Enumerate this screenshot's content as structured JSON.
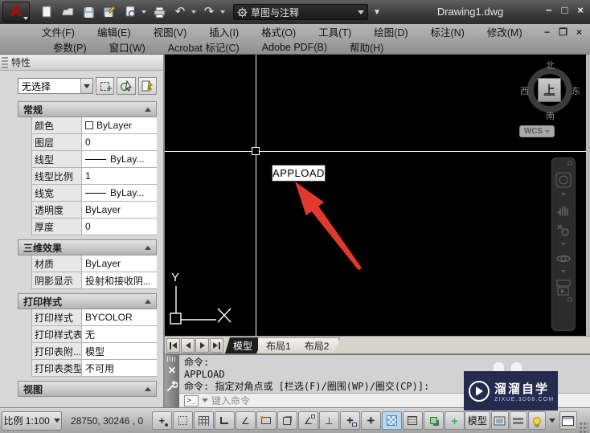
{
  "app": {
    "doc_title": "Drawing1.dwg",
    "workspace": "草图与注释"
  },
  "titlebar": {
    "window_controls": {
      "minimize": "−",
      "maximize": "□",
      "close": "×"
    }
  },
  "menubar": {
    "row1": [
      "文件(F)",
      "编辑(E)",
      "视图(V)",
      "插入(I)",
      "格式(O)",
      "工具(T)",
      "绘图(D)",
      "标注(N)",
      "修改(M)"
    ],
    "row2": [
      "参数(P)",
      "窗口(W)",
      "Acrobat 标记(C)",
      "Adobe PDF(B)",
      "帮助(H)"
    ],
    "doc_window_controls": {
      "minimize": "−",
      "restore": "❐",
      "close": "×"
    }
  },
  "properties_panel": {
    "title": "特性",
    "selector_value": "无选择",
    "sections": [
      {
        "title": "常规",
        "rows": [
          {
            "label": "颜色",
            "value": "ByLayer"
          },
          {
            "label": "图层",
            "value": "0"
          },
          {
            "label": "线型",
            "value": "ByLay..."
          },
          {
            "label": "线型比例",
            "value": "1"
          },
          {
            "label": "线宽",
            "value": "ByLay..."
          },
          {
            "label": "透明度",
            "value": "ByLayer"
          },
          {
            "label": "厚度",
            "value": "0"
          }
        ]
      },
      {
        "title": "三维效果",
        "rows": [
          {
            "label": "材质",
            "value": "ByLayer"
          },
          {
            "label": "阴影显示",
            "value": "投射和接收阴..."
          }
        ]
      },
      {
        "title": "打印样式",
        "rows": [
          {
            "label": "打印样式",
            "value": "BYCOLOR"
          },
          {
            "label": "打印样式表",
            "value": "无"
          },
          {
            "label": "打印表附...",
            "value": "模型"
          },
          {
            "label": "打印表类型",
            "value": "不可用"
          }
        ]
      },
      {
        "title": "视图",
        "rows": []
      }
    ]
  },
  "drawing": {
    "tooltip": "APPLOAD",
    "viewcube": {
      "north": "北",
      "south": "南",
      "west": "西",
      "east": "东",
      "top": "上"
    },
    "wcs_label": "WCS",
    "ucs_axis_x": "X",
    "ucs_axis_y": "Y"
  },
  "layout_tabs": {
    "tabs": [
      {
        "label": "模型",
        "active": true
      },
      {
        "label": "布局1",
        "active": false
      },
      {
        "label": "布局2",
        "active": false
      }
    ]
  },
  "command_line": {
    "history": [
      "命令:",
      "APPLOAD",
      "命令: 指定对角点或 [栏选(F)/圈围(WP)/圈交(CP)]:"
    ],
    "prompt": ">_",
    "placeholder": "键入命令"
  },
  "status_bar": {
    "scale_label": "比例 1:100",
    "coordinates": "28750,   30246 ,  0",
    "model_button": "模型",
    "toggle_icons": [
      "infer-constraints",
      "snap-mode",
      "grid-display",
      "ortho-mode",
      "polar-tracking",
      "object-snap",
      "3d-object-snap",
      "object-snap-tracking",
      "dynamic-ucs",
      "dynamic-input",
      "lineweight",
      "transparency",
      "quick-properties",
      "selection-cycling",
      "annotation-monitor"
    ]
  },
  "watermark": {
    "brand": "溜溜自学",
    "url": "zixue.3d66.com"
  },
  "colors": {
    "accent_red": "#e0392e",
    "watermark_bg": "#232c4f",
    "active_toggle": "#b9d6ee"
  }
}
